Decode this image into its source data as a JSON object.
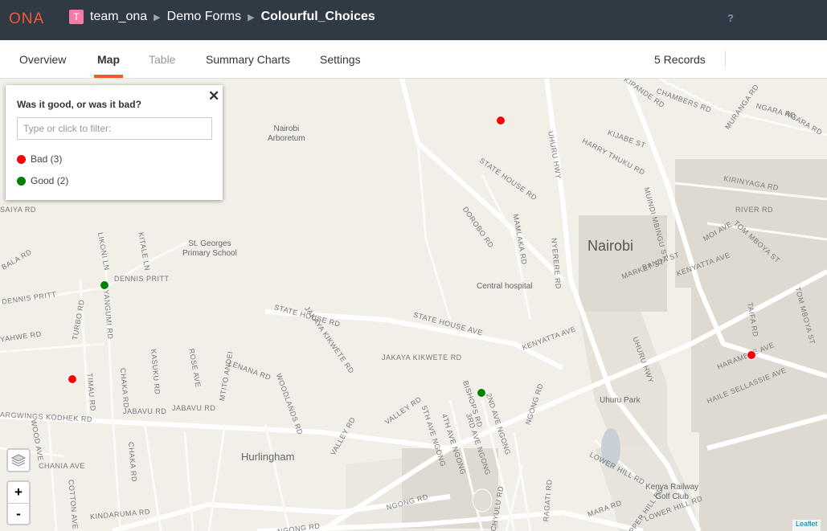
{
  "header": {
    "logo": "ONA",
    "org_badge": "T",
    "org": "team_ona",
    "project": "Demo Forms",
    "form": "Colourful_Choices",
    "help": "?"
  },
  "tabs": [
    {
      "label": "Overview"
    },
    {
      "label": "Map"
    },
    {
      "label": "Table"
    },
    {
      "label": "Summary Charts"
    },
    {
      "label": "Settings"
    }
  ],
  "records": "5 Records",
  "legend": {
    "title": "Was it good, or was it bad?",
    "close": "✕",
    "filter_placeholder": "Type or click to filter:",
    "items": [
      {
        "label": "Bad (3)",
        "color": "#ff0000"
      },
      {
        "label": "Good (2)",
        "color": "#008000"
      }
    ]
  },
  "map": {
    "city": "Nairobi",
    "neighbourhood": "Hurlingham",
    "places": {
      "arboretum": "Nairobi\nArboretum",
      "school": "St. Georges\nPrimary School",
      "hospital": "Central hospital",
      "park": "Uhuru Park",
      "golf": "Kenya Railway\nGolf Club"
    },
    "roads": [
      "KIPANDE RD",
      "CHAMBERS RD",
      "MURANGA RD",
      "NGARA RD",
      "NGARA RD",
      "KIJABE ST",
      "HARRY THUKU RD",
      "UHURU HWY",
      "STATE HOUSE RD",
      "KIRINYAGA RD",
      "RIVER RD",
      "MOI AVE",
      "TOM MBOYA ST",
      "DOROBO RD",
      "MAMLAKA RD",
      "MUINDI MBINGU ST",
      "MARKET ST",
      "BANDA ST",
      "KENYATTA AVE",
      "NYERERE RD",
      "TOM MBOYA ST",
      "LIKONI LN",
      "KITALE LN",
      "DENNIS PRITT",
      "DENNIS PRITT",
      "NYANGUMI RD",
      "TURBO RD",
      "STATE HOUSE RD",
      "STATE HOUSE AVE",
      "JAKAYA KIKWETE RD",
      "JAKAYA KIKWETE RD",
      "KENYATTA AVE",
      "UHURU HWY",
      "TAIFA RD",
      "HARAMBEE AVE",
      "HAILE SELLASSIE AVE",
      "LENANA RD",
      "CHAKA RD",
      "KASUKU RD",
      "ROSE AVE",
      "MTITO ANDEI",
      "TIMAU RD",
      "ARGWINGS KODHEK RD",
      "JABAVU RD",
      "JABAVU RD",
      "WOODLANDS RD",
      "VALLEY RD",
      "VALLEY RD",
      "BISHOPS RD",
      "2ND AVE NGONG",
      "5TH AVE NGONG",
      "4TH AVE NGONG",
      "3RD AVE NGONG",
      "NGONG RD",
      "NGONG RD",
      "NGONG RD",
      "WOOD AVE",
      "CHANIA AVE",
      "COTTON AVE",
      "KINDARUMA RD",
      "CHYULU RD",
      "RAGATI RD",
      "MARA RD",
      "UPPER HILL RD",
      "LOWER HILL RD",
      "LOWER HILL RD",
      "SAIYA RD",
      "BALA RD",
      "YAHWE RD",
      "CHAKA RD",
      "ARBORETUM",
      "KOMA RD"
    ]
  },
  "markers": [
    {
      "category": "Bad",
      "color": "#ff0000"
    },
    {
      "category": "Good",
      "color": "#008000"
    },
    {
      "category": "Bad",
      "color": "#ff0000"
    },
    {
      "category": "Good",
      "color": "#008000"
    },
    {
      "category": "Bad",
      "color": "#ff0000"
    }
  ],
  "controls": {
    "zoom_in": "+",
    "zoom_out": "-"
  },
  "attribution": "Leaflet"
}
